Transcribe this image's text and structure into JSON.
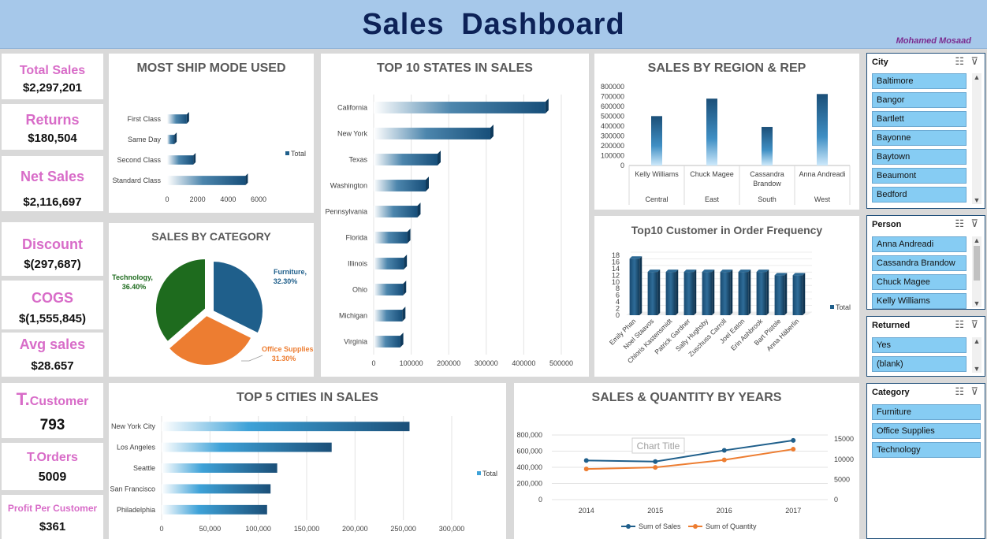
{
  "header": {
    "title": "Sales  Dashboard",
    "author": "Mohamed Mosaad"
  },
  "kpis": {
    "total_sales": {
      "label": "Total Sales",
      "value": "$2,297,201"
    },
    "returns": {
      "label": "Returns",
      "value": "$180,504"
    },
    "net_sales": {
      "label": "Net Sales",
      "value": "$2,116,697"
    },
    "discount": {
      "label": "Discount",
      "value": "$(297,687)"
    },
    "cogs": {
      "label": "COGS",
      "value": "$(1,555,845)"
    },
    "avg_sales": {
      "label": "Avg sales",
      "value": "$28.657"
    },
    "t_customer": {
      "label_big": "T.",
      "label_small": "Customer",
      "value": "793"
    },
    "t_orders": {
      "label": "T.Orders",
      "value": "5009"
    },
    "profit_per_customer": {
      "label": "Profit Per Customer",
      "value": "$361"
    }
  },
  "panels": {
    "ship_mode": "MOST SHIP MODE USED",
    "top_states": "TOP 10 STATES IN SALES",
    "region_rep": "SALES BY REGION  & REP",
    "category": "SALES BY CATEGORY",
    "customer_freq": "Top10 Customer in Order Frequency",
    "top_cities": "TOP 5 CITIES IN SALES",
    "years": "SALES & QUANTITY  BY YEARS"
  },
  "chart_data": [
    {
      "id": "ship_mode",
      "type": "bar",
      "orientation": "horizontal",
      "categories": [
        "First Class",
        "Same Day",
        "Second Class",
        "Standard Class"
      ],
      "values": [
        1500,
        550,
        2000,
        6000
      ],
      "xticks": [
        "0",
        "2000",
        "4000",
        "6000"
      ],
      "xlim": [
        0,
        7000
      ],
      "legend": [
        "Total"
      ],
      "legend_position": "right"
    },
    {
      "id": "top_states",
      "type": "bar",
      "orientation": "horizontal",
      "categories": [
        "California",
        "New York",
        "Texas",
        "Washington",
        "Pennsylvania",
        "Florida",
        "Illinois",
        "Ohio",
        "Michigan",
        "Virginia"
      ],
      "values": [
        457688,
        310876,
        170188,
        138641,
        116512,
        89474,
        80166,
        78258,
        76270,
        70637
      ],
      "xticks": [
        "0",
        "100000",
        "200000",
        "300000",
        "400000",
        "500000"
      ],
      "xlim": [
        0,
        500000
      ]
    },
    {
      "id": "region_rep",
      "type": "bar",
      "categories": [
        "Kelly Williams",
        "Chuck Magee",
        "Cassandra Brandow",
        "Anna Andreadi"
      ],
      "groups": [
        "Central",
        "East",
        "South",
        "West"
      ],
      "values": [
        501240,
        678781,
        391722,
        725458
      ],
      "yticks": [
        "0",
        "100000",
        "200000",
        "300000",
        "400000",
        "500000",
        "600000",
        "700000",
        "800000"
      ],
      "ylim": [
        0,
        800000
      ]
    },
    {
      "id": "category",
      "type": "pie",
      "labels": [
        "Furniture, 32.30%",
        "Office Supplies, 31.30%",
        "Technology, 36.40%"
      ],
      "values": [
        32.3,
        31.3,
        36.4
      ],
      "colors": [
        "#1f5f8b",
        "#ed7d31",
        "#1e6b1e"
      ]
    },
    {
      "id": "customer_freq",
      "type": "bar",
      "categories": [
        "Emily Phan",
        "Noel Staavos",
        "Chloris Kastensmidt",
        "Patrick Gardner",
        "Sally Hughsby",
        "Zuschuss Carroll",
        "Joel Eaton",
        "Erin Ashbrook",
        "Bart Pistole",
        "Anna Häberlin"
      ],
      "values": [
        17,
        13,
        13,
        13,
        13,
        13,
        13,
        13,
        12,
        12
      ],
      "yticks": [
        "0",
        "2",
        "4",
        "6",
        "8",
        "10",
        "12",
        "14",
        "16",
        "18"
      ],
      "ylim": [
        0,
        18
      ],
      "legend": [
        "Total"
      ],
      "legend_position": "right"
    },
    {
      "id": "top_cities",
      "type": "bar",
      "orientation": "horizontal",
      "categories": [
        "New York City",
        "Los Angeles",
        "Seattle",
        "San Francisco",
        "Philadelphia"
      ],
      "values": [
        256368,
        175851,
        119540,
        112669,
        109077
      ],
      "xticks": [
        "0",
        "50,000",
        "100,000",
        "150,000",
        "200,000",
        "250,000",
        "300,000"
      ],
      "xlim": [
        0,
        300000
      ],
      "legend": [
        "Total"
      ],
      "legend_position": "right"
    },
    {
      "id": "years",
      "type": "line",
      "x": [
        "2014",
        "2015",
        "2016",
        "2017"
      ],
      "series": [
        {
          "name": "Sum of Sales",
          "values": [
            484247,
            470533,
            609206,
            733215
          ],
          "axis": "left",
          "color": "#1f5f8b"
        },
        {
          "name": "Sum of Quantity",
          "values": [
            7581,
            7979,
            9837,
            12476
          ],
          "axis": "right",
          "color": "#ed7d31"
        }
      ],
      "yticks_left": [
        "0",
        "200,000",
        "400,000",
        "600,000",
        "800,000"
      ],
      "ylim_left": [
        0,
        800000
      ],
      "yticks_right": [
        "0",
        "5000",
        "10000",
        "15000"
      ],
      "ylim_right": [
        0,
        15000
      ],
      "annotation": "Chart Title",
      "legend_position": "bottom"
    }
  ],
  "slicers": {
    "city": {
      "title": "City",
      "items": [
        "Baltimore",
        "Bangor",
        "Bartlett",
        "Bayonne",
        "Baytown",
        "Beaumont",
        "Bedford"
      ]
    },
    "person": {
      "title": "Person",
      "items": [
        "Anna Andreadi",
        "Cassandra Brandow",
        "Chuck Magee",
        "Kelly Williams"
      ]
    },
    "returned": {
      "title": "Returned",
      "items": [
        "Yes",
        "(blank)"
      ]
    },
    "category": {
      "title": "Category",
      "items": [
        "Furniture",
        "Office Supplies",
        "Technology"
      ]
    }
  },
  "icons": {
    "multiselect": "multi-select-icon",
    "clear_filter": "clear-filter-icon"
  }
}
